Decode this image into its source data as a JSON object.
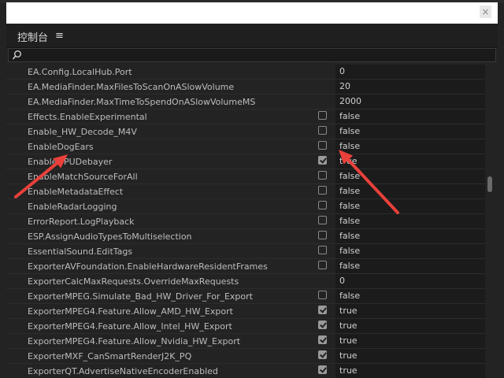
{
  "panel": {
    "title": "控制台",
    "menu_icon": "hamburger-menu-icon",
    "close_glyph": "×"
  },
  "search": {
    "placeholder": "",
    "value": "",
    "icon": "search-icon"
  },
  "rows": [
    {
      "name": "EA.Config.LocalHub.Port",
      "type": "text",
      "value": "0"
    },
    {
      "name": "EA.MediaFinder.MaxFilesToScanOnASlowVolume",
      "type": "text",
      "value": "20"
    },
    {
      "name": "EA.MediaFinder.MaxTimeToSpendOnASlowVolumeMS",
      "type": "text",
      "value": "2000"
    },
    {
      "name": "Effects.EnableExperimental",
      "type": "bool",
      "checked": false,
      "value": "false"
    },
    {
      "name": "Enable_HW_Decode_M4V",
      "type": "bool",
      "checked": false,
      "value": "false"
    },
    {
      "name": "EnableDogEars",
      "type": "bool",
      "checked": false,
      "value": "false"
    },
    {
      "name": "EnableGPUDebayer",
      "type": "bool",
      "checked": true,
      "value": "true"
    },
    {
      "name": "EnableMatchSourceForAll",
      "type": "bool",
      "checked": false,
      "value": "false"
    },
    {
      "name": "EnableMetadataEffect",
      "type": "bool",
      "checked": false,
      "value": "false"
    },
    {
      "name": "EnableRadarLogging",
      "type": "bool",
      "checked": false,
      "value": "false"
    },
    {
      "name": "ErrorReport.LogPlayback",
      "type": "bool",
      "checked": false,
      "value": "false"
    },
    {
      "name": "ESP.AssignAudioTypesToMultiselection",
      "type": "bool",
      "checked": false,
      "value": "false"
    },
    {
      "name": "EssentialSound.EditTags",
      "type": "bool",
      "checked": false,
      "value": "false"
    },
    {
      "name": "ExporterAVFoundation.EnableHardwareResidentFrames",
      "type": "bool",
      "checked": false,
      "value": "false"
    },
    {
      "name": "ExporterCalcMaxRequests.OverrideMaxRequests",
      "type": "text",
      "value": "0"
    },
    {
      "name": "ExporterMPEG.Simulate_Bad_HW_Driver_For_Export",
      "type": "bool",
      "checked": false,
      "value": "false"
    },
    {
      "name": "ExporterMPEG4.Feature.Allow_AMD_HW_Export",
      "type": "bool",
      "checked": true,
      "value": "true"
    },
    {
      "name": "ExporterMPEG4.Feature.Allow_Intel_HW_Export",
      "type": "bool",
      "checked": true,
      "value": "true"
    },
    {
      "name": "ExporterMPEG4.Feature.Allow_Nvidia_HW_Export",
      "type": "bool",
      "checked": true,
      "value": "true"
    },
    {
      "name": "ExporterMXF_CanSmartRenderJ2K_PQ",
      "type": "bool",
      "checked": true,
      "value": "true"
    },
    {
      "name": "ExporterQT.AdvertiseNativeEncoderEnabled",
      "type": "bool",
      "checked": true,
      "value": "true"
    }
  ],
  "annotation_color": "#e8403a"
}
